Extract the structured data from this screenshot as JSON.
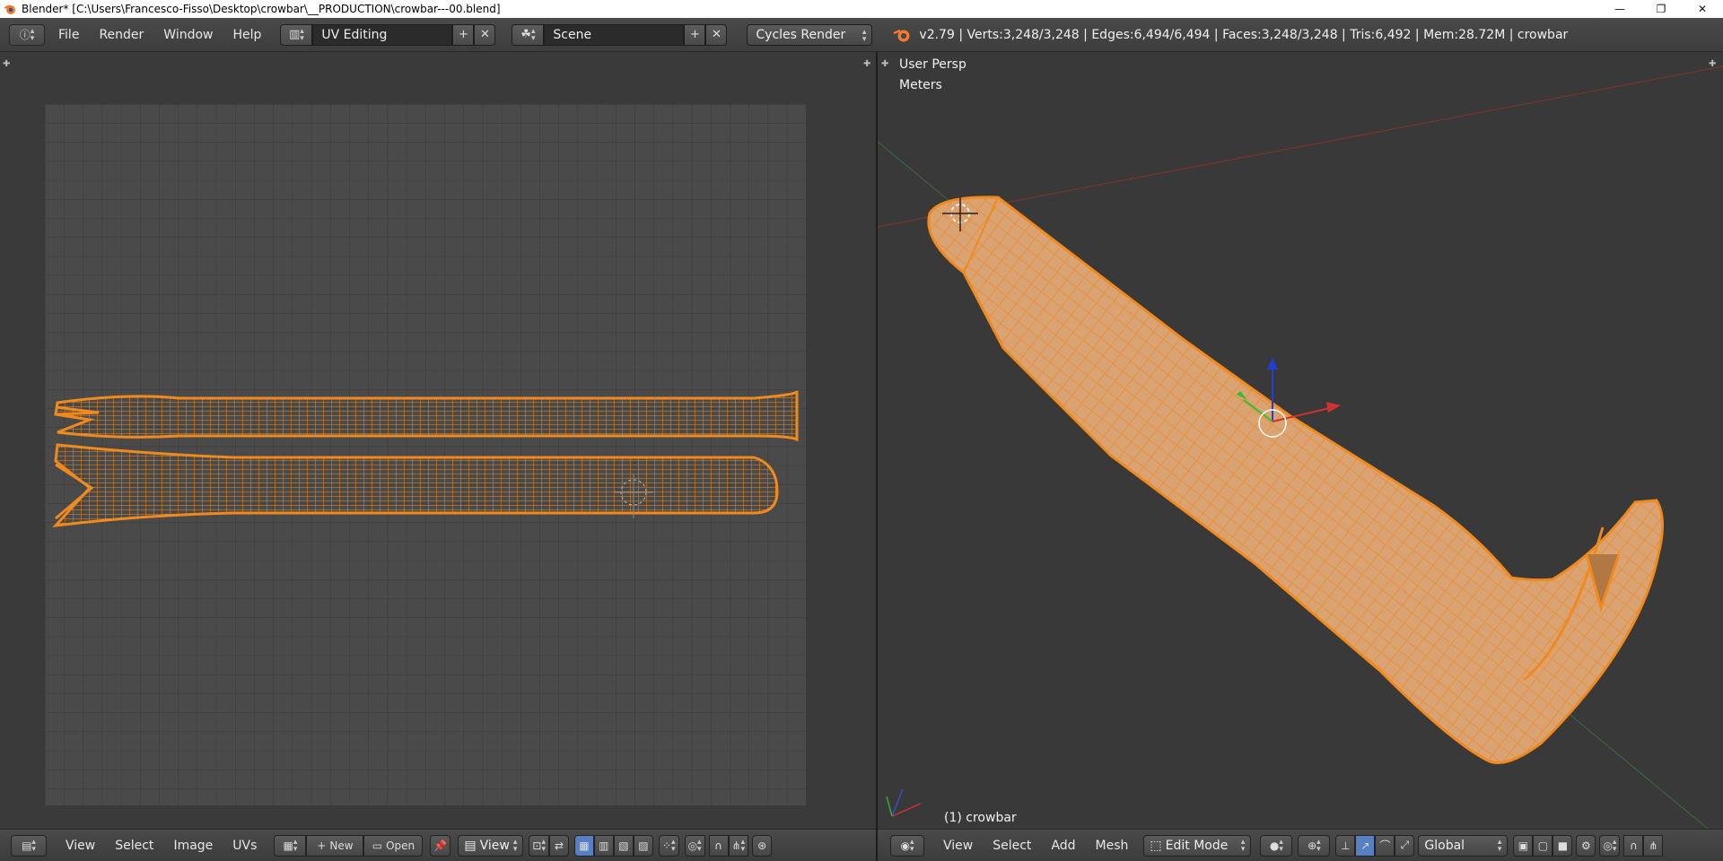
{
  "window": {
    "title": "Blender* [C:\\Users\\Francesco-Fisso\\Desktop\\crowbar\\__PRODUCTION\\crowbar---00.blend]",
    "minimize": "—",
    "maximize": "❐",
    "close": "✕"
  },
  "info_header": {
    "menus": [
      "File",
      "Render",
      "Window",
      "Help"
    ],
    "screen_layout": "UV Editing",
    "scene": "Scene",
    "render_engine": "Cycles Render",
    "stats": "v2.79 | Verts:3,248/3,248 | Edges:6,494/6,494 | Faces:3,248/3,248 | Tris:6,492 | Mem:28.72M | crowbar"
  },
  "view3d": {
    "view_name": "User Persp",
    "units": "Meters",
    "object_label": "(1) crowbar"
  },
  "uv_header": {
    "menus": [
      "View",
      "Select",
      "Image",
      "UVs"
    ],
    "new_label": "New",
    "open_label": "Open",
    "view_dropdown": "View"
  },
  "view3d_header": {
    "menus": [
      "View",
      "Select",
      "Add",
      "Mesh"
    ],
    "mode": "Edit Mode",
    "orientation": "Global"
  },
  "colors": {
    "accent_orange": "#f08a1d",
    "mesh_face": "#d9a374",
    "grid_line": "#2f2f2f",
    "selected_button": "#5680c2"
  }
}
